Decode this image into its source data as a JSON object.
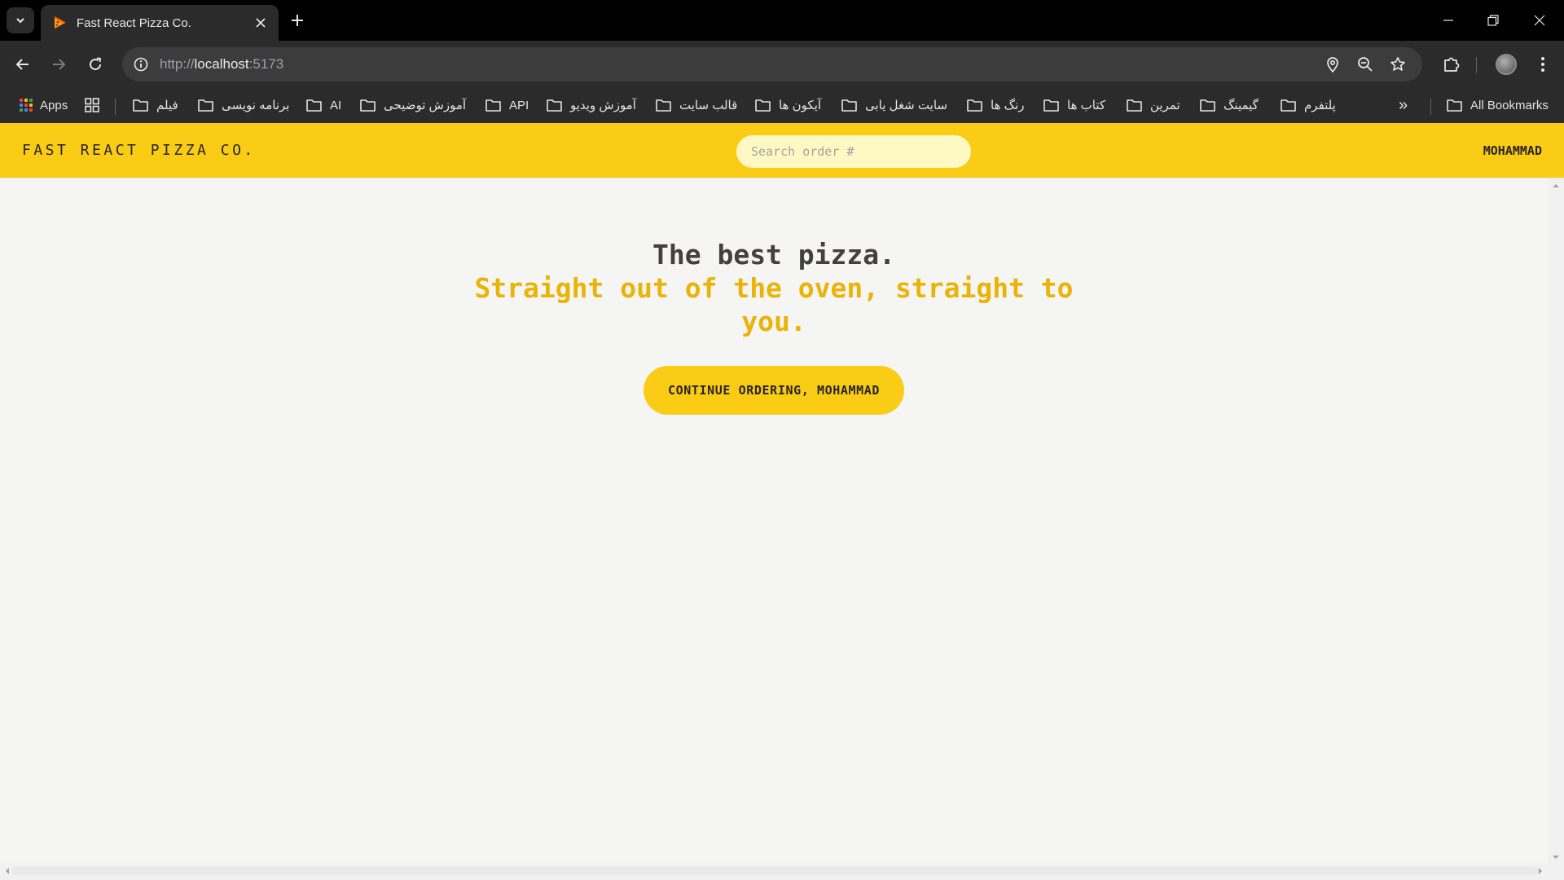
{
  "browser": {
    "tab_title": "Fast React Pizza Co.",
    "url_scheme": "http://",
    "url_host": "localhost",
    "url_port": ":5173",
    "bookmarks_overflow_label": "»",
    "all_bookmarks_label": "All Bookmarks",
    "bookmarks": [
      {
        "label": "Apps",
        "icon": "apps-grid-icon"
      },
      {
        "label": "",
        "icon": "tab-groups-icon"
      },
      {
        "label": "فیلم",
        "icon": "folder-icon"
      },
      {
        "label": "برنامه نویسی",
        "icon": "folder-icon"
      },
      {
        "label": "AI",
        "icon": "folder-icon"
      },
      {
        "label": "آموزش توضیحی",
        "icon": "folder-icon"
      },
      {
        "label": "API",
        "icon": "folder-icon"
      },
      {
        "label": "آموزش ویدیو",
        "icon": "folder-icon"
      },
      {
        "label": "قالب سایت",
        "icon": "folder-icon"
      },
      {
        "label": "آیکون ها",
        "icon": "folder-icon"
      },
      {
        "label": "سایت شغل یابی",
        "icon": "folder-icon"
      },
      {
        "label": "رنگ ها",
        "icon": "folder-icon"
      },
      {
        "label": "کتاب ها",
        "icon": "folder-icon"
      },
      {
        "label": "تمرین",
        "icon": "folder-icon"
      },
      {
        "label": "گیمینگ",
        "icon": "folder-icon"
      },
      {
        "label": "پلتفرم",
        "icon": "folder-icon"
      }
    ]
  },
  "app": {
    "logo": "FAST REACT PIZZA CO.",
    "search_placeholder": "Search order #",
    "username": "MOHAMMAD",
    "hero_title": "The best pizza.",
    "hero_subtitle": "Straight out of the oven, straight to you.",
    "cta_label": "CONTINUE ORDERING, MOHAMMAD"
  },
  "colors": {
    "brand_yellow": "#facc15",
    "accent_yellow_text": "#eab308",
    "search_bg": "#fef9c3",
    "page_bg": "#f5f5f4",
    "chrome_bg": "#2b2b2b"
  }
}
